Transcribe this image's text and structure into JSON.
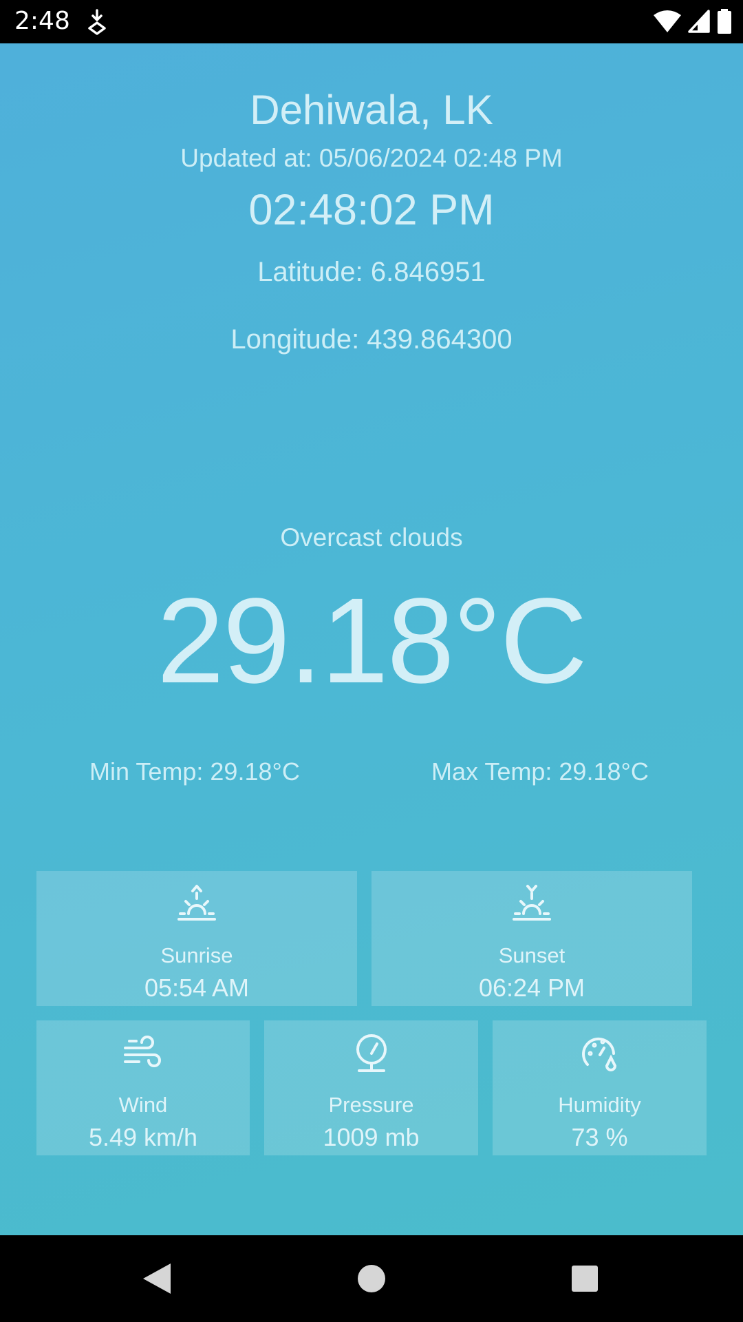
{
  "status_bar": {
    "time": "2:48",
    "icons": [
      "download-icon",
      "wifi-icon",
      "signal-icon",
      "battery-icon"
    ]
  },
  "weather": {
    "city": "Dehiwala, LK",
    "updated_at": "Updated at: 05/06/2024 02:48 PM",
    "clock": "02:48:02 PM",
    "latitude": "Latitude: 6.846951",
    "longitude": "Longitude: 439.864300",
    "condition": "Overcast clouds",
    "temperature": "29.18°C",
    "min_temp": "Min Temp: 29.18°C",
    "max_temp": "Max Temp: 29.18°C"
  },
  "details": {
    "sunrise": {
      "label": "Sunrise",
      "value": "05:54 AM",
      "icon": "sunrise-icon"
    },
    "sunset": {
      "label": "Sunset",
      "value": "06:24 PM",
      "icon": "sunset-icon"
    },
    "wind": {
      "label": "Wind",
      "value": "5.49 km/h",
      "icon": "wind-icon"
    },
    "pressure": {
      "label": "Pressure",
      "value": "1009 mb",
      "icon": "pressure-gauge-icon"
    },
    "humidity": {
      "label": "Humidity",
      "value": "73 %",
      "icon": "humidity-icon"
    }
  },
  "colors": {
    "background_top": "#4fb0da",
    "background_bottom": "#4bbccc",
    "text": "#cdeef6"
  },
  "nav_bar": {
    "buttons": [
      "back-icon",
      "home-icon",
      "recents-icon"
    ]
  }
}
